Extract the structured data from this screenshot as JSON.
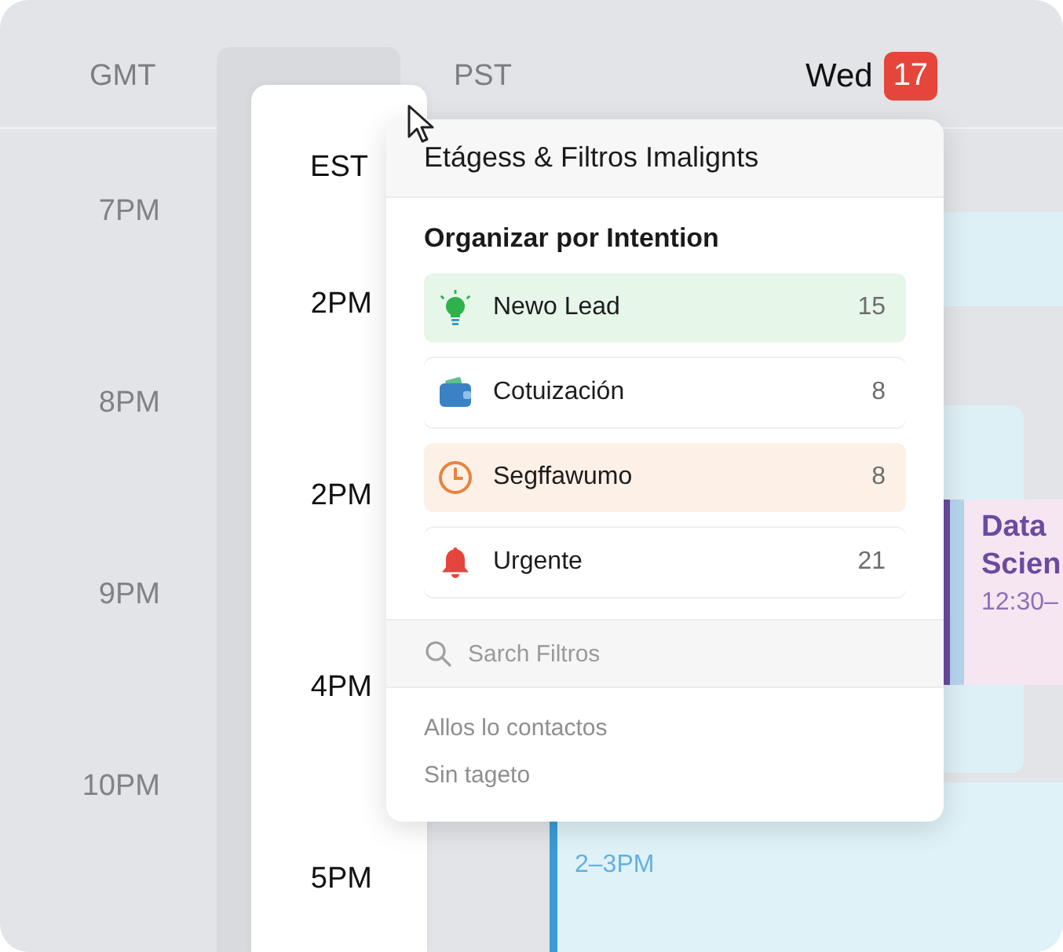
{
  "calendar": {
    "zones": [
      "GMT",
      "PST"
    ],
    "day": {
      "name": "Wed",
      "date": "17"
    },
    "gmt_times": [
      "7PM",
      "8PM",
      "9PM",
      "10PM"
    ],
    "est": {
      "label": "EST",
      "times": [
        "2PM",
        "2PM",
        "4PM",
        "5PM"
      ]
    },
    "events": [
      {
        "title_lines": [
          "Data",
          "Scien"
        ],
        "time": "12:30–",
        "color": "#6b4aa0"
      },
      {
        "time": "2–3PM",
        "color": "#3a9bd6"
      }
    ]
  },
  "popup": {
    "title": "Etágess & Filtros Imalignts",
    "section_title": "Organizar por Intention",
    "items": [
      {
        "label": "Newo Lead",
        "count": "15",
        "selected": true,
        "color": "#2fb24c"
      },
      {
        "label": "Cotuización",
        "count": "8",
        "selected": false,
        "color": "#3b82c4"
      },
      {
        "label": "Segffawumo",
        "count": "8",
        "selected": true,
        "color": "#e8843c"
      },
      {
        "label": "Urgente",
        "count": "21",
        "selected": false,
        "color": "#e5453b"
      }
    ],
    "search": {
      "placeholder": "Sarch Filtros"
    },
    "footer_links": [
      "Allos lo contactos",
      "Sin tageto"
    ]
  }
}
